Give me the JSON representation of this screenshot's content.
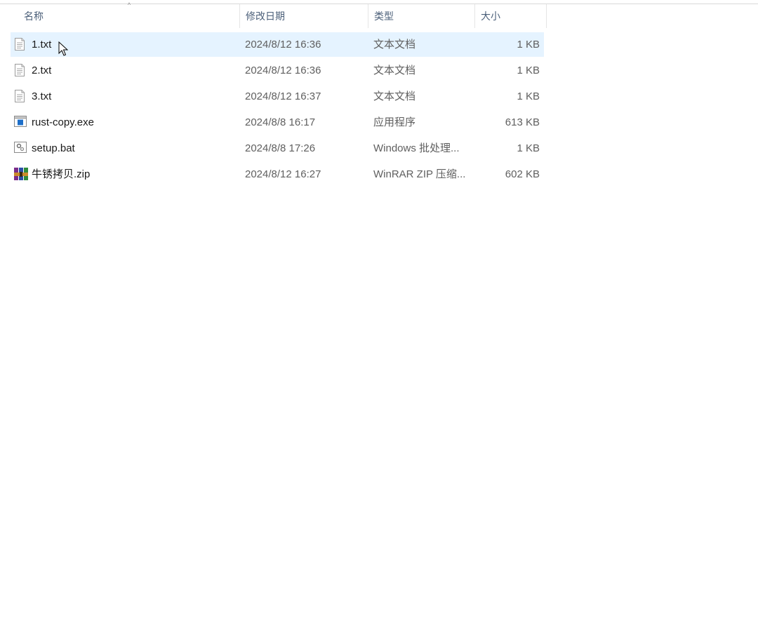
{
  "columns": {
    "name": "名称",
    "date": "修改日期",
    "type": "类型",
    "size": "大小"
  },
  "files": [
    {
      "name": "1.txt",
      "date": "2024/8/12 16:36",
      "type": "文本文档",
      "size": "1 KB",
      "icon": "text-file-icon",
      "selected": true
    },
    {
      "name": "2.txt",
      "date": "2024/8/12 16:36",
      "type": "文本文档",
      "size": "1 KB",
      "icon": "text-file-icon",
      "selected": false
    },
    {
      "name": "3.txt",
      "date": "2024/8/12 16:37",
      "type": "文本文档",
      "size": "1 KB",
      "icon": "text-file-icon",
      "selected": false
    },
    {
      "name": "rust-copy.exe",
      "date": "2024/8/8 16:17",
      "type": "应用程序",
      "size": "613 KB",
      "icon": "application-icon",
      "selected": false
    },
    {
      "name": "setup.bat",
      "date": "2024/8/8 17:26",
      "type": "Windows 批处理...",
      "size": "1 KB",
      "icon": "batch-file-icon",
      "selected": false
    },
    {
      "name": "牛锈拷贝.zip",
      "date": "2024/8/12 16:27",
      "type": "WinRAR ZIP 压缩...",
      "size": "602 KB",
      "icon": "winrar-archive-icon",
      "selected": false
    }
  ],
  "colors": {
    "selection": "#e5f3ff",
    "header_text": "#4c607a"
  }
}
